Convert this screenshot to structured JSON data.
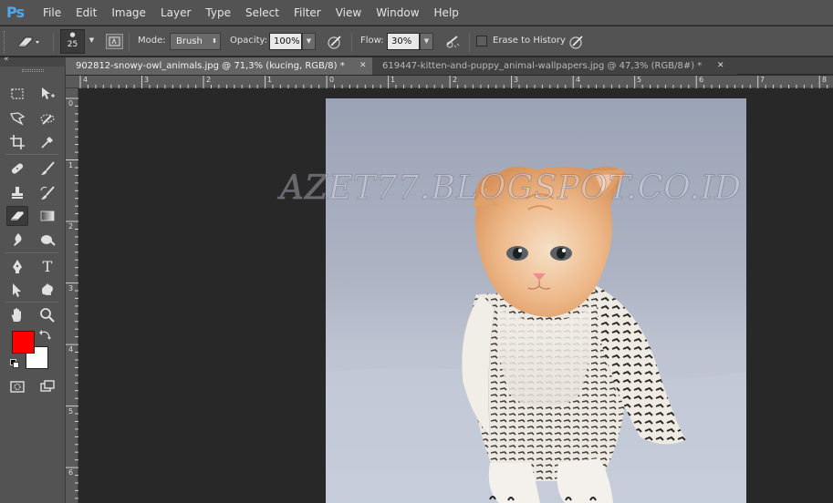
{
  "app": {
    "logo": "Ps"
  },
  "menu": [
    "File",
    "Edit",
    "Image",
    "Layer",
    "Type",
    "Select",
    "Filter",
    "View",
    "Window",
    "Help"
  ],
  "options": {
    "tool_icon": "eraser-icon",
    "brush_size": "25",
    "mode_label": "Mode:",
    "mode_value": "Brush",
    "opacity_label": "Opacity:",
    "opacity_value": "100%",
    "flow_label": "Flow:",
    "flow_value": "30%",
    "erase_history_label": "Erase to History",
    "erase_history_checked": false
  },
  "tabs": [
    {
      "title": "902812-snowy-owl_animals.jpg @ 71,3% (kucing, RGB/8) *",
      "active": true
    },
    {
      "title": "619447-kitten-and-puppy_animal-wallpapers.jpg @ 47,3% (RGB/8#) *",
      "active": false
    }
  ],
  "ruler": {
    "horizontal": [
      "4",
      "3",
      "2",
      "1",
      "0",
      "1",
      "2",
      "3",
      "4",
      "5",
      "6",
      "7",
      "8"
    ],
    "vertical": [
      "0",
      "1",
      "2",
      "3",
      "4",
      "5",
      "6"
    ]
  },
  "colors": {
    "foreground": "#ff0000",
    "background": "#ffffff",
    "accent": "#4fa8e8"
  },
  "canvas": {
    "watermark": "AZET77.BLOGSPOT.CO.ID"
  }
}
